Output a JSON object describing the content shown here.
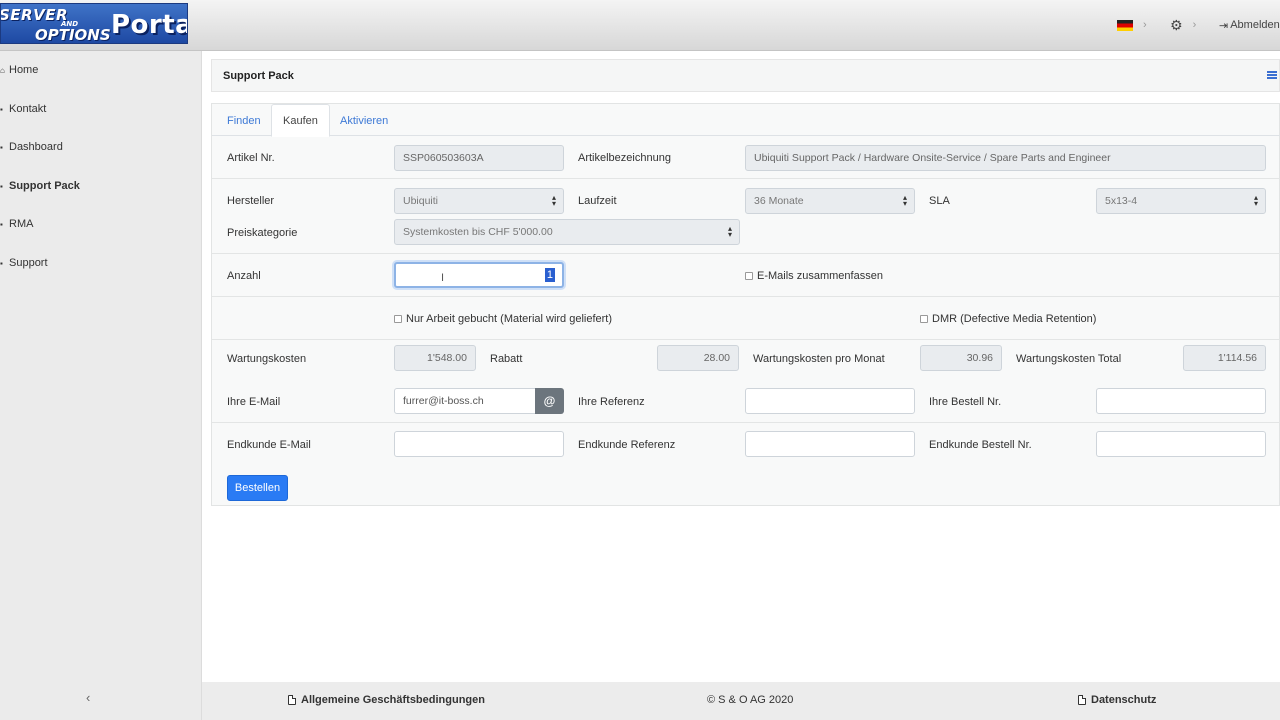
{
  "header": {
    "logo_text": {
      "line1": "SERVER",
      "line2": "AND",
      "line3": "OPTIONS",
      "line4": "Portal"
    },
    "language_flag": "german-flag-icon",
    "logout_label": "Abmelden"
  },
  "sidebar": {
    "items": [
      {
        "label": "Home",
        "icon": "home-icon"
      },
      {
        "label": "Kontakt",
        "icon": "contact-icon"
      },
      {
        "label": "Dashboard",
        "icon": "dashboard-icon"
      },
      {
        "label": "Support Pack",
        "icon": "support-pack-icon",
        "active": true
      },
      {
        "label": "RMA",
        "icon": "rma-icon"
      },
      {
        "label": "Support",
        "icon": "support-icon"
      }
    ],
    "collapse_glyph": "‹"
  },
  "panel": {
    "title": "Support Pack"
  },
  "tabs": [
    {
      "label": "Finden"
    },
    {
      "label": "Kaufen",
      "active": true
    },
    {
      "label": "Aktivieren"
    }
  ],
  "form": {
    "artikel_nr": {
      "label": "Artikel Nr.",
      "value": "SSP060503603A"
    },
    "artikelbezeichnung": {
      "label": "Artikelbezeichnung",
      "value": "Ubiquiti Support Pack / Hardware Onsite-Service / Spare Parts and Engineer"
    },
    "hersteller": {
      "label": "Hersteller",
      "value": "Ubiquiti"
    },
    "laufzeit": {
      "label": "Laufzeit",
      "value": "36 Monate"
    },
    "sla": {
      "label": "SLA",
      "value": "5x13-4"
    },
    "preiskategorie": {
      "label": "Preiskategorie",
      "value": "Systemkosten bis CHF 5'000.00"
    },
    "anzahl": {
      "label": "Anzahl",
      "value": "1"
    },
    "emails_zusammenfassen": {
      "label": "E-Mails zusammenfassen",
      "checked": false
    },
    "nur_arbeit": {
      "label": "Nur Arbeit gebucht (Material wird geliefert)",
      "checked": false
    },
    "dmr": {
      "label": "DMR (Defective Media Retention)",
      "checked": false
    },
    "wartungskosten": {
      "label": "Wartungskosten",
      "value": "1'548.00"
    },
    "rabatt": {
      "label": "Rabatt",
      "value": "28.00"
    },
    "wartungskosten_monat": {
      "label": "Wartungskosten pro Monat",
      "value": "30.96"
    },
    "wartungskosten_total": {
      "label": "Wartungskosten Total",
      "value": "1'114.56"
    },
    "ihre_email": {
      "label": "Ihre E-Mail",
      "value": "furrer@it-boss.ch",
      "button": "@"
    },
    "ihre_referenz": {
      "label": "Ihre Referenz",
      "value": ""
    },
    "ihre_bestell_nr": {
      "label": "Ihre Bestell Nr.",
      "value": ""
    },
    "endkunde_email": {
      "label": "Endkunde E-Mail",
      "value": ""
    },
    "endkunde_referenz": {
      "label": "Endkunde Referenz",
      "value": ""
    },
    "endkunde_bestell_nr": {
      "label": "Endkunde Bestell Nr.",
      "value": ""
    },
    "submit_label": "Bestellen"
  },
  "footer": {
    "agb": "Allgemeine Geschäftsbedingungen",
    "copyright": "© S & O AG 2020",
    "datenschutz": "Datenschutz"
  }
}
